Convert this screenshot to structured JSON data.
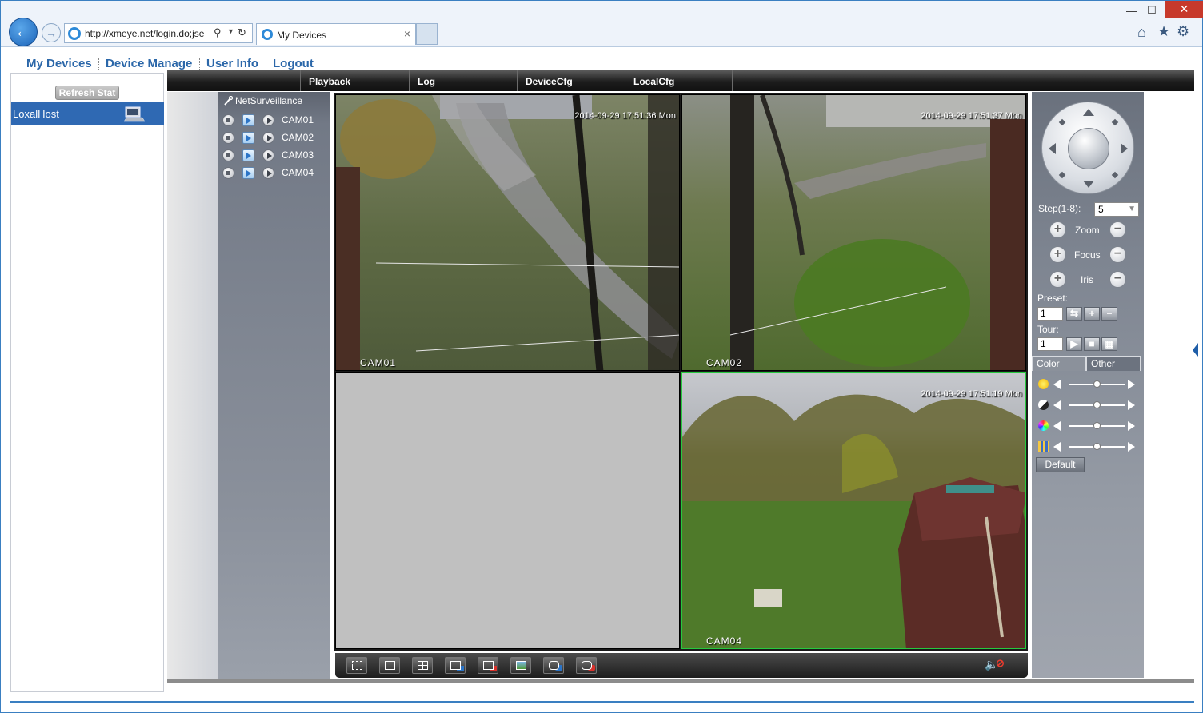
{
  "browser": {
    "url": "http://xmeye.net/login.do;jse",
    "tab_title": "My Devices",
    "tab_close": "×",
    "window_min": "—",
    "window_max": "☐",
    "window_close": "✕"
  },
  "topnav": {
    "items": [
      "My Devices",
      "Device Manage",
      "User Info",
      "Logout"
    ]
  },
  "device_list": {
    "refresh_label": "Refresh Stat",
    "hosts": [
      {
        "name": "LoxalHost"
      }
    ]
  },
  "menubar": {
    "items": [
      "Playback",
      "Log",
      "DeviceCfg",
      "LocalCfg"
    ]
  },
  "tree": {
    "root": "NetSurveillance",
    "cameras": [
      "CAM01",
      "CAM02",
      "CAM03",
      "CAM04"
    ]
  },
  "video": {
    "cells": [
      {
        "label": "CAM01",
        "timestamp": "2014-09-29 17:51:36 Mon",
        "selected": false
      },
      {
        "label": "CAM02",
        "timestamp": "2014-09-29 17:51:37 Mon",
        "selected": false
      },
      {
        "label": "",
        "timestamp": "",
        "selected": false,
        "empty": true
      },
      {
        "label": "CAM04",
        "timestamp": "2014-09-29 17:51:19 Mon",
        "selected": true
      }
    ],
    "toolbar_icons": [
      "fullscreen-icon",
      "single-view-icon",
      "quad-view-icon",
      "start-all-icon",
      "stop-all-icon",
      "snapshot-icon",
      "record-start-icon",
      "record-stop-icon"
    ]
  },
  "ptz": {
    "step_label": "Step(1-8):",
    "step_value": "5",
    "zoom_label": "Zoom",
    "focus_label": "Focus",
    "iris_label": "Iris",
    "preset_label": "Preset:",
    "preset_value": "1",
    "tour_label": "Tour:",
    "tour_value": "1",
    "tabs": [
      "Color",
      "Other"
    ],
    "sliders": [
      {
        "icon": "brightness-icon",
        "value": 0.5
      },
      {
        "icon": "contrast-icon",
        "value": 0.5
      },
      {
        "icon": "saturation-icon",
        "value": 0.5
      },
      {
        "icon": "hue-icon",
        "value": 0.5
      }
    ],
    "default_label": "Default"
  },
  "colors": {
    "accent": "#2f69b3",
    "nav_link": "#2b67a9",
    "selected_border": "#27c93f"
  }
}
